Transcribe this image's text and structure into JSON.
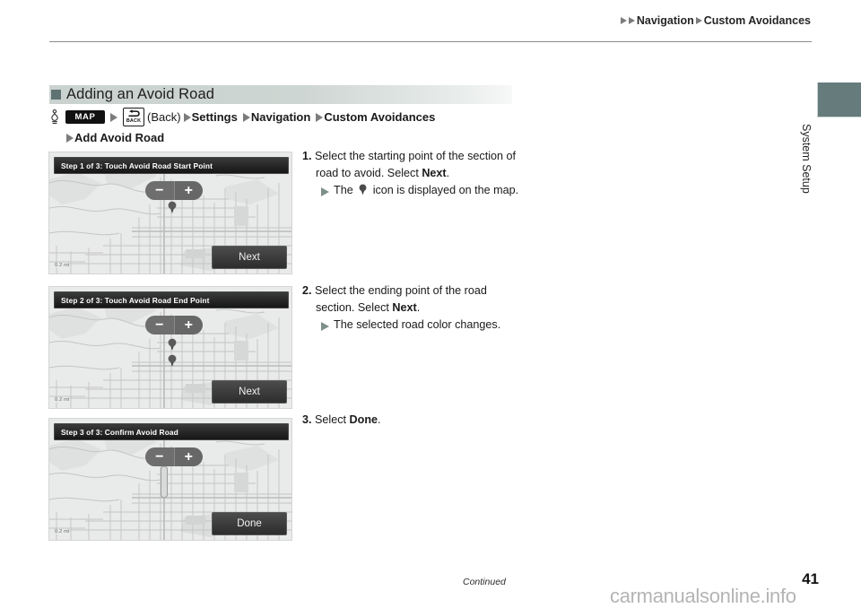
{
  "header": {
    "breadcrumb": [
      "Navigation",
      "Custom Avoidances"
    ]
  },
  "side_tab": {
    "label": "System Setup",
    "color": "#667b7b"
  },
  "section": {
    "title": "Adding an Avoid Road",
    "bullet_color": "#5f7272"
  },
  "nav_path": {
    "hand_icon": "hand-pointer-icon",
    "map_button": "MAP",
    "back_button": "BACK",
    "back_label": "(Back)",
    "items": [
      "Settings",
      "Navigation",
      "Custom Avoidances"
    ],
    "second_line": "Add Avoid Road"
  },
  "screenshots": [
    {
      "title": "Step 1 of 3: Touch Avoid Road Start Point",
      "action_label": "Next",
      "scale_label": "0.2 mi",
      "zoom_out": "−",
      "zoom_in": "+",
      "pins": 1
    },
    {
      "title": "Step 2 of 3: Touch Avoid Road End Point",
      "action_label": "Next",
      "scale_label": "0.2 mi",
      "zoom_out": "−",
      "zoom_in": "+",
      "pins": 2
    },
    {
      "title": "Step 3 of 3: Confirm Avoid Road",
      "action_label": "Done",
      "scale_label": "0.2 mi",
      "zoom_out": "−",
      "zoom_in": "+",
      "pins": 0
    }
  ],
  "steps": [
    {
      "number": "1.",
      "text_a": "Select the starting point of the section of road to avoid. Select ",
      "bold": "Next",
      "text_b": ".",
      "sub_a": "The ",
      "sub_icon": "map-pin-icon",
      "sub_b": " icon is displayed on the map."
    },
    {
      "number": "2.",
      "text_a": "Select the ending point of the road section. Select ",
      "bold": "Next",
      "text_b": ".",
      "sub_a": "The selected road color changes.",
      "sub_icon": "",
      "sub_b": ""
    },
    {
      "number": "3.",
      "text_a": "Select ",
      "bold": "Done",
      "text_b": ".",
      "sub_a": "",
      "sub_icon": "",
      "sub_b": ""
    }
  ],
  "footer": {
    "continued": "Continued",
    "page_number": "41",
    "watermark": "carmanualsonline.info"
  }
}
